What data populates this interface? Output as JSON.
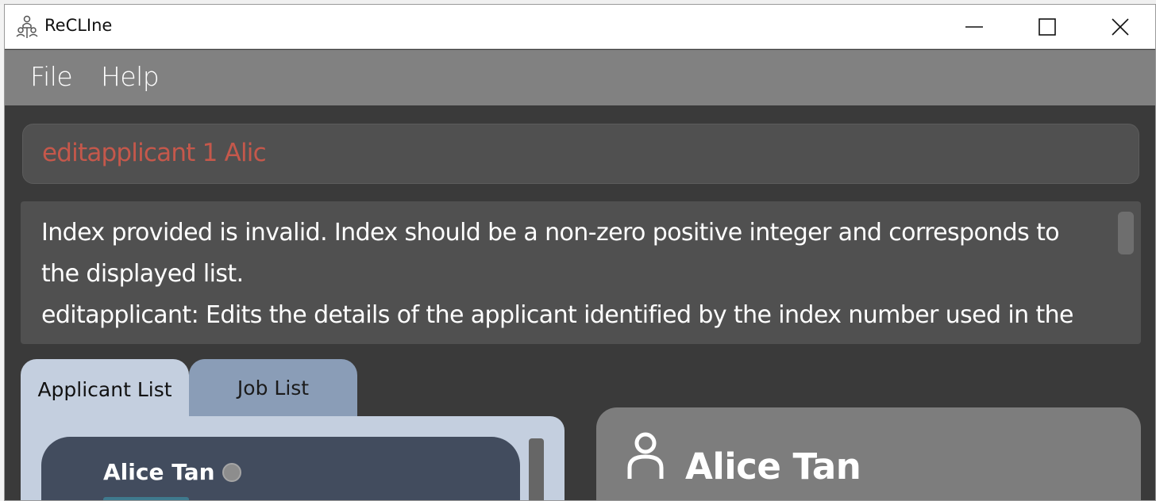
{
  "window": {
    "title": "ReCLIne"
  },
  "menu": {
    "items": [
      {
        "label": "File"
      },
      {
        "label": "Help"
      }
    ]
  },
  "command": {
    "value": "editapplicant 1 Alic",
    "text_color": "#c5584b"
  },
  "result": {
    "lines": [
      "Index provided is invalid. Index should be a non-zero positive integer and corresponds to",
      "the displayed list.",
      "editapplicant: Edits the details of the applicant identified by the index number used in the"
    ]
  },
  "tabs": {
    "items": [
      {
        "label": "Applicant List",
        "selected": true
      },
      {
        "label": "Job List",
        "selected": false
      }
    ]
  },
  "applicant_list": {
    "items": [
      {
        "name": "Alice Tan"
      }
    ]
  },
  "detail": {
    "name": "Alice Tan",
    "icon": "person-icon"
  },
  "colors": {
    "menubar": "#818181",
    "tab_active": "#c4cfdf",
    "tab_inactive": "#8a9db7",
    "card": "#424c5e",
    "detail_panel": "#7d7d7d"
  }
}
